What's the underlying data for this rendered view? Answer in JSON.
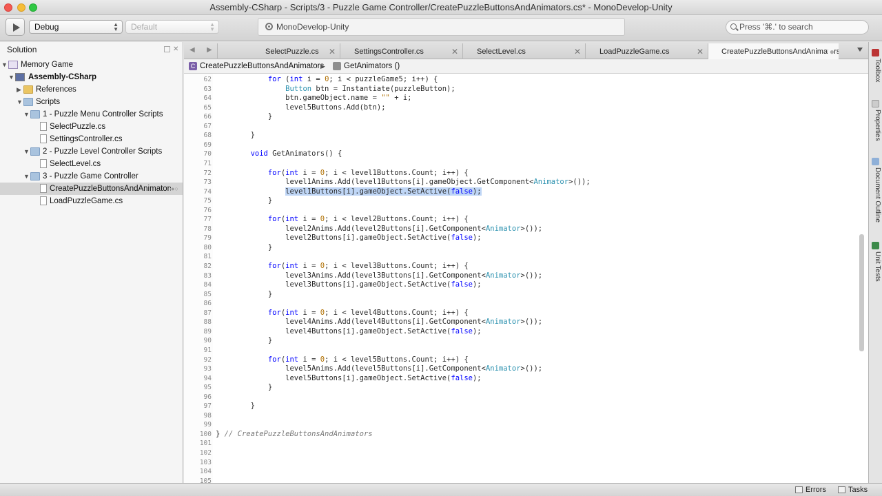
{
  "window": {
    "title": "Assembly-CSharp - Scripts/3 - Puzzle Game Controller/CreatePuzzleButtonsAndAnimators.cs* - MonoDevelop-Unity"
  },
  "toolbar": {
    "config": "Debug",
    "platform": "Default",
    "status": "MonoDevelop-Unity",
    "search_placeholder": "Press '⌘.' to search"
  },
  "sidebar": {
    "title": "Solution",
    "items": [
      {
        "label": "Memory Game"
      },
      {
        "label": "Assembly-CSharp"
      },
      {
        "label": "References"
      },
      {
        "label": "Scripts"
      },
      {
        "label": "1 - Puzzle Menu Controller Scripts"
      },
      {
        "label": "SelectPuzzle.cs"
      },
      {
        "label": "SettingsController.cs"
      },
      {
        "label": "2 - Puzzle Level Controller Scripts"
      },
      {
        "label": "SelectLevel.cs"
      },
      {
        "label": "3 - Puzzle Game Controller"
      },
      {
        "label": "CreatePuzzleButtonsAndAnimators.cs"
      },
      {
        "label": "LoadPuzzleGame.cs"
      }
    ]
  },
  "tabs": [
    {
      "label": "SelectPuzzle.cs"
    },
    {
      "label": "SettingsController.cs"
    },
    {
      "label": "SelectLevel.cs"
    },
    {
      "label": "LoadPuzzleGame.cs"
    },
    {
      "label": "CreatePuzzleButtonsAndAnimators.cs"
    }
  ],
  "breadcrumb": {
    "class": "CreatePuzzleButtonsAndAnimators",
    "method": "GetAnimators ()"
  },
  "code": [
    {
      "n": "62",
      "t": "            for (int i = 0; i < puzzleGame5; i++) {"
    },
    {
      "n": "63",
      "t": "                Button btn = Instantiate(puzzleButton);"
    },
    {
      "n": "64",
      "t": "                btn.gameObject.name = \"\" + i;"
    },
    {
      "n": "65",
      "t": "                level5Buttons.Add(btn);"
    },
    {
      "n": "66",
      "t": "            }"
    },
    {
      "n": "67",
      "t": ""
    },
    {
      "n": "68",
      "t": "        }"
    },
    {
      "n": "69",
      "t": ""
    },
    {
      "n": "70",
      "t": "        void GetAnimators() {"
    },
    {
      "n": "71",
      "t": ""
    },
    {
      "n": "72",
      "t": "            for(int i = 0; i < level1Buttons.Count; i++) {"
    },
    {
      "n": "73",
      "t": "                level1Anims.Add(level1Buttons[i].gameObject.GetComponent<Animator>());"
    },
    {
      "n": "74",
      "t": "                level1Buttons[i].gameObject.SetActive(false);"
    },
    {
      "n": "75",
      "t": "            }"
    },
    {
      "n": "76",
      "t": ""
    },
    {
      "n": "77",
      "t": "            for(int i = 0; i < level2Buttons.Count; i++) {"
    },
    {
      "n": "78",
      "t": "                level2Anims.Add(level2Buttons[i].GetComponent<Animator>());"
    },
    {
      "n": "79",
      "t": "                level2Buttons[i].gameObject.SetActive(false);"
    },
    {
      "n": "80",
      "t": "            }"
    },
    {
      "n": "81",
      "t": ""
    },
    {
      "n": "82",
      "t": "            for(int i = 0; i < level3Buttons.Count; i++) {"
    },
    {
      "n": "83",
      "t": "                level3Anims.Add(level3Buttons[i].GetComponent<Animator>());"
    },
    {
      "n": "84",
      "t": "                level3Buttons[i].gameObject.SetActive(false);"
    },
    {
      "n": "85",
      "t": "            }"
    },
    {
      "n": "86",
      "t": ""
    },
    {
      "n": "87",
      "t": "            for(int i = 0; i < level4Buttons.Count; i++) {"
    },
    {
      "n": "88",
      "t": "                level4Anims.Add(level4Buttons[i].GetComponent<Animator>());"
    },
    {
      "n": "89",
      "t": "                level4Buttons[i].gameObject.SetActive(false);"
    },
    {
      "n": "90",
      "t": "            }"
    },
    {
      "n": "91",
      "t": ""
    },
    {
      "n": "92",
      "t": "            for(int i = 0; i < level5Buttons.Count; i++) {"
    },
    {
      "n": "93",
      "t": "                level5Anims.Add(level5Buttons[i].GetComponent<Animator>());"
    },
    {
      "n": "94",
      "t": "                level5Buttons[i].gameObject.SetActive(false);"
    },
    {
      "n": "95",
      "t": "            }"
    },
    {
      "n": "96",
      "t": ""
    },
    {
      "n": "97",
      "t": "        }"
    },
    {
      "n": "98",
      "t": ""
    },
    {
      "n": "99",
      "t": ""
    },
    {
      "n": "100",
      "t": "} // CreatePuzzleButtonsAndAnimators"
    },
    {
      "n": "101",
      "t": ""
    },
    {
      "n": "102",
      "t": ""
    },
    {
      "n": "103",
      "t": ""
    },
    {
      "n": "104",
      "t": ""
    },
    {
      "n": "105",
      "t": ""
    }
  ],
  "dock": [
    "Toolbox",
    "Properties",
    "Document Outline",
    "Unit Tests"
  ],
  "statusbar": {
    "errors": "Errors",
    "tasks": "Tasks"
  },
  "colors": {
    "keyword": "#0000ff",
    "type": "#2b91af",
    "number": "#b06f00",
    "comment": "#7a7a7a",
    "selection": "#bfd6f6"
  }
}
